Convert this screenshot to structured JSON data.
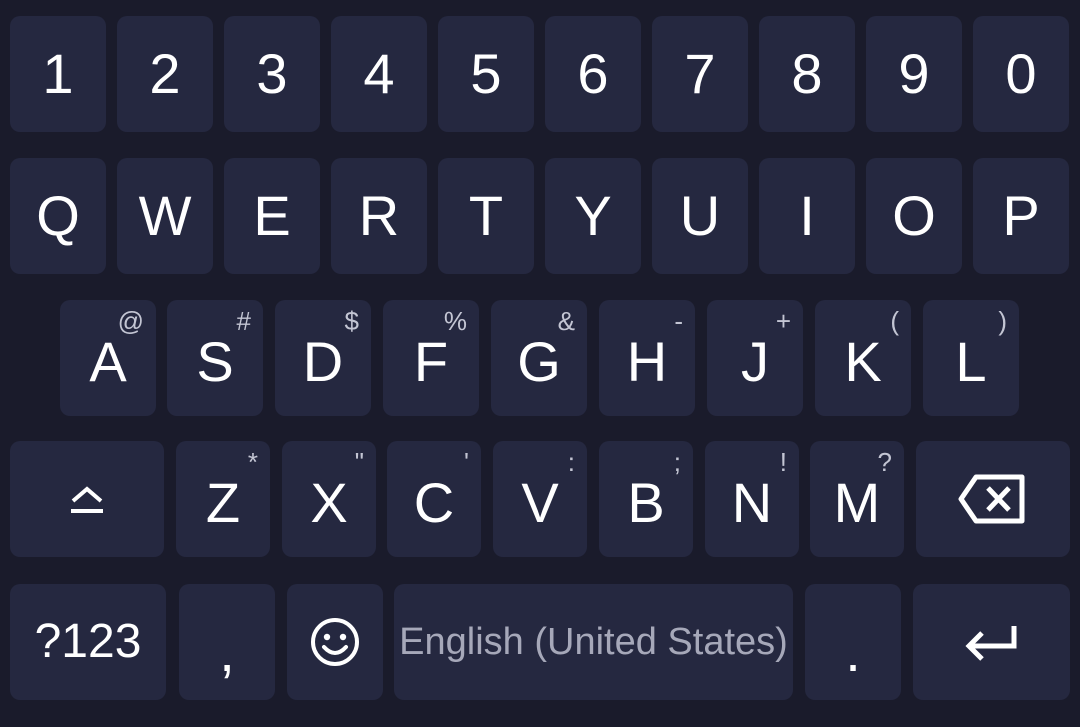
{
  "keyboard": {
    "number_row": [
      "1",
      "2",
      "3",
      "4",
      "5",
      "6",
      "7",
      "8",
      "9",
      "0"
    ],
    "row1": [
      "Q",
      "W",
      "E",
      "R",
      "T",
      "Y",
      "U",
      "I",
      "O",
      "P"
    ],
    "row2": [
      {
        "label": "A",
        "hint": "@"
      },
      {
        "label": "S",
        "hint": "#"
      },
      {
        "label": "D",
        "hint": "$"
      },
      {
        "label": "F",
        "hint": "%"
      },
      {
        "label": "G",
        "hint": "&"
      },
      {
        "label": "H",
        "hint": "-"
      },
      {
        "label": "J",
        "hint": "+"
      },
      {
        "label": "K",
        "hint": "("
      },
      {
        "label": "L",
        "hint": ")"
      }
    ],
    "row3": [
      {
        "label": "Z",
        "hint": "*"
      },
      {
        "label": "X",
        "hint": "\""
      },
      {
        "label": "C",
        "hint": "'"
      },
      {
        "label": "V",
        "hint": ":"
      },
      {
        "label": "B",
        "hint": ";"
      },
      {
        "label": "N",
        "hint": "!"
      },
      {
        "label": "M",
        "hint": "?"
      }
    ],
    "bottom": {
      "symbols_label": "?123",
      "comma_label": ",",
      "space_label": "English (United States)",
      "period_label": "."
    },
    "icons": {
      "shift": "shift-icon",
      "backspace": "backspace-icon",
      "emoji": "emoji-icon",
      "enter": "enter-icon"
    },
    "colors": {
      "background": "#1a1b2b",
      "key": "#252840",
      "text": "#ffffff",
      "hint": "#c3c5d3",
      "space_text": "#a6a8b9"
    }
  }
}
